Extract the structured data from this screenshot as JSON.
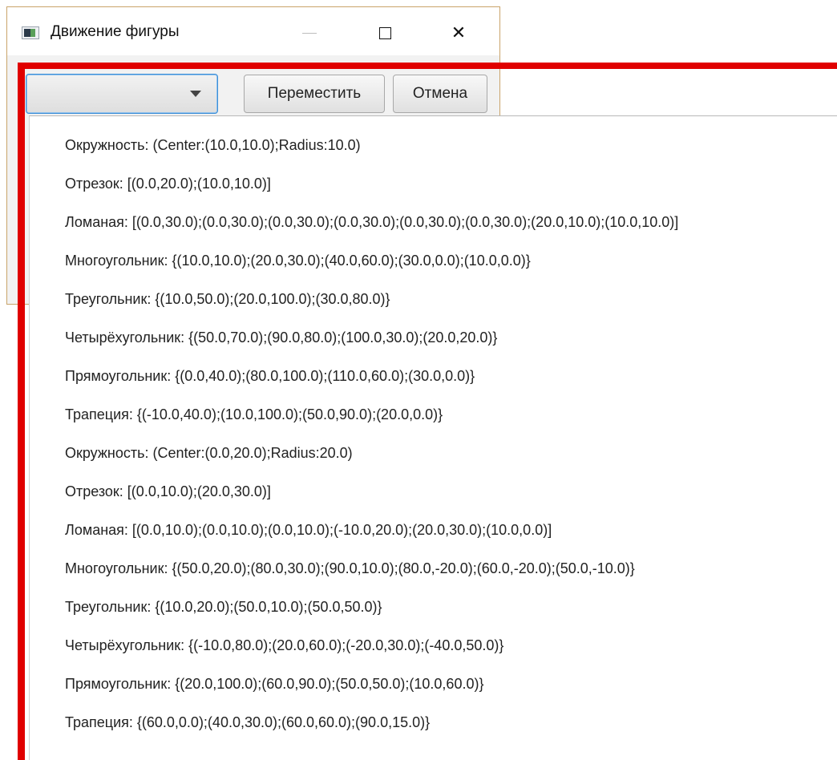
{
  "window": {
    "title": "Движение фигуры",
    "controls": [
      "minimize",
      "maximize",
      "close"
    ],
    "close_glyph": "✕"
  },
  "toolbar": {
    "combo_value": "",
    "move_label": "Переместить",
    "cancel_label": "Отмена"
  },
  "dropdown": {
    "items": [
      "Окружность: (Center:(10.0,10.0);Radius:10.0)",
      "Отрезок: [(0.0,20.0);(10.0,10.0)]",
      "Ломаная: [(0.0,30.0);(0.0,30.0);(0.0,30.0);(0.0,30.0);(0.0,30.0);(0.0,30.0);(20.0,10.0);(10.0,10.0)]",
      "Многоугольник: {(10.0,10.0);(20.0,30.0);(40.0,60.0);(30.0,0.0);(10.0,0.0)}",
      "Треугольник: {(10.0,50.0);(20.0,100.0);(30.0,80.0)}",
      "Четырёхугольник: {(50.0,70.0);(90.0,80.0);(100.0,30.0);(20.0,20.0)}",
      "Прямоугольник: {(0.0,40.0);(80.0,100.0);(110.0,60.0);(30.0,0.0)}",
      "Трапеция: {(-10.0,40.0);(10.0,100.0);(50.0,90.0);(20.0,0.0)}",
      "Окружность: (Center:(0.0,20.0);Radius:20.0)",
      "Отрезок: [(0.0,10.0);(20.0,30.0)]",
      "Ломаная: [(0.0,10.0);(0.0,10.0);(0.0,10.0);(-10.0,20.0);(20.0,30.0);(10.0,0.0)]",
      "Многоугольник: {(50.0,20.0);(80.0,30.0);(90.0,10.0);(80.0,-20.0);(60.0,-20.0);(50.0,-10.0)}",
      "Треугольник: {(10.0,20.0);(50.0,10.0);(50.0,50.0)}",
      "Четырёхугольник: {(-10.0,80.0);(20.0,60.0);(-20.0,30.0);(-40.0,50.0)}",
      "Прямоугольник: {(20.0,100.0);(60.0,90.0);(50.0,50.0);(10.0,60.0)}",
      "Трапеция: {(60.0,0.0);(40.0,30.0);(60.0,60.0);(90.0,15.0)}"
    ]
  },
  "colors": {
    "highlight_red": "#e00000",
    "combo_focus": "#3c8fd8"
  }
}
